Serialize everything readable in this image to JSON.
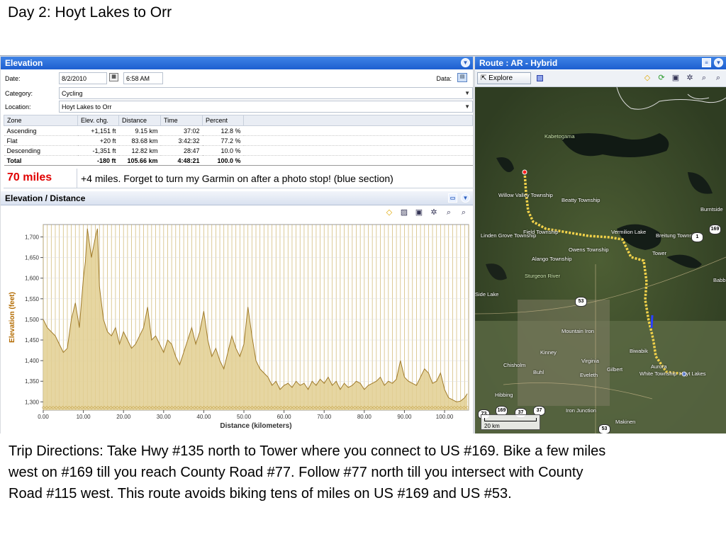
{
  "slide_title": "Day 2: Hoyt Lakes to Orr",
  "elevation_pane": {
    "title": "Elevation",
    "date_label": "Date:",
    "date_value": "8/2/2010",
    "time_value": "6:58 AM",
    "data_label": "Data:",
    "category_label": "Category:",
    "category_value": "Cycling",
    "location_label": "Location:",
    "location_value": "Hoyt Lakes to Orr",
    "zones": {
      "headers": [
        "Zone",
        "Elev. chg.",
        "Distance",
        "Time",
        "Percent"
      ],
      "rows": [
        [
          "Ascending",
          "+1,151 ft",
          "9.15 km",
          "37:02",
          "12.8 %"
        ],
        [
          "Flat",
          "+20 ft",
          "83.68 km",
          "3:42:32",
          "77.2 %"
        ],
        [
          "Descending",
          "-1,351 ft",
          "12.82 km",
          "28:47",
          "10.0 %"
        ]
      ],
      "total": [
        "Total",
        "-180 ft",
        "105.66 km",
        "4:48:21",
        "100.0 %"
      ]
    },
    "note_red": "70 miles",
    "note_text": "+4 miles. Forget to turn my Garmin on after a photo stop! (blue section)"
  },
  "elevation_distance": {
    "title": "Elevation / Distance"
  },
  "chart_data": {
    "type": "area",
    "xlabel": "Distance (kilometers)",
    "ylabel": "Elevation (feet)",
    "xlim": [
      0,
      106
    ],
    "ylim": [
      1280,
      1730
    ],
    "x_ticks": [
      "0.00",
      "10.00",
      "20.00",
      "30.00",
      "40.00",
      "50.00",
      "60.00",
      "70.00",
      "80.00",
      "90.00",
      "100.00"
    ],
    "y_ticks": [
      "1,300",
      "1,350",
      "1,400",
      "1,450",
      "1,500",
      "1,550",
      "1,600",
      "1,650",
      "1,700"
    ],
    "grid": true,
    "fill_color": "#e2cf92",
    "line_color": "#a07b2a",
    "x": [
      0,
      1,
      2,
      3,
      4,
      5,
      6,
      7,
      8,
      9,
      10,
      10.5,
      11,
      12,
      13,
      13.5,
      14,
      15,
      16,
      17,
      18,
      19,
      20,
      21,
      22,
      23,
      24,
      25,
      26,
      27,
      28,
      29,
      30,
      31,
      32,
      33,
      34,
      35,
      36,
      37,
      38,
      39,
      40,
      41,
      42,
      43,
      44,
      45,
      46,
      47,
      48,
      49,
      50,
      51,
      52,
      53,
      54,
      55,
      56,
      57,
      58,
      59,
      60,
      61,
      62,
      63,
      64,
      65,
      66,
      67,
      68,
      69,
      70,
      71,
      72,
      73,
      74,
      75,
      76,
      77,
      78,
      79,
      80,
      81,
      82,
      83,
      84,
      85,
      86,
      87,
      88,
      89,
      90,
      91,
      92,
      93,
      94,
      95,
      96,
      97,
      98,
      99,
      100,
      101,
      102,
      103,
      104,
      105,
      105.66
    ],
    "y": [
      1500,
      1480,
      1470,
      1460,
      1440,
      1420,
      1430,
      1500,
      1540,
      1480,
      1600,
      1640,
      1720,
      1650,
      1700,
      1720,
      1580,
      1500,
      1470,
      1460,
      1480,
      1440,
      1470,
      1450,
      1430,
      1440,
      1460,
      1480,
      1530,
      1450,
      1460,
      1440,
      1420,
      1450,
      1440,
      1410,
      1390,
      1420,
      1450,
      1480,
      1440,
      1470,
      1520,
      1450,
      1410,
      1430,
      1400,
      1380,
      1420,
      1460,
      1430,
      1410,
      1440,
      1530,
      1460,
      1400,
      1380,
      1370,
      1360,
      1340,
      1350,
      1330,
      1340,
      1345,
      1335,
      1350,
      1340,
      1345,
      1330,
      1350,
      1340,
      1355,
      1345,
      1360,
      1340,
      1350,
      1330,
      1345,
      1335,
      1340,
      1350,
      1345,
      1330,
      1340,
      1345,
      1350,
      1360,
      1340,
      1350,
      1345,
      1355,
      1400,
      1360,
      1350,
      1345,
      1340,
      1360,
      1380,
      1370,
      1345,
      1350,
      1370,
      1330,
      1310,
      1305,
      1300,
      1302,
      1310,
      1320
    ]
  },
  "route_pane": {
    "title": "Route : AR - Hybrid",
    "explore_label": "Explore",
    "scale_label": "20 km",
    "labels": [
      {
        "text": "Kabetogama",
        "green": true
      },
      {
        "text": "Willow Valley Township"
      },
      {
        "text": "Beatty Township"
      },
      {
        "text": "Burntside"
      },
      {
        "text": "Linden Grove Township"
      },
      {
        "text": "Field Township"
      },
      {
        "text": "Owens Township"
      },
      {
        "text": "Vermilion Lake"
      },
      {
        "text": "Breitung Township"
      },
      {
        "text": "Tower"
      },
      {
        "text": "Alango Township"
      },
      {
        "text": "Sturgeon River",
        "green": true
      },
      {
        "text": "Side Lake"
      },
      {
        "text": "Babbitt"
      },
      {
        "text": "Mountain Iron"
      },
      {
        "text": "Kinney"
      },
      {
        "text": "Biwabik"
      },
      {
        "text": "Aurora"
      },
      {
        "text": "Hoyt Lakes"
      },
      {
        "text": "Chisholm"
      },
      {
        "text": "Buhl"
      },
      {
        "text": "Virginia"
      },
      {
        "text": "Gilbert"
      },
      {
        "text": "Eveleth"
      },
      {
        "text": "White Township"
      },
      {
        "text": "Hibbing"
      },
      {
        "text": "Iron Junction"
      },
      {
        "text": "Makinen"
      }
    ],
    "shields": [
      "169",
      "1",
      "53",
      "169",
      "37",
      "37",
      "53",
      "73"
    ]
  },
  "directions": "Trip Directions: Take Hwy #135 north to Tower where you connect to US #169. Bike a few miles west on #169 till you reach County Road #77. Follow #77 north till you intersect with County Road #115 west. This route avoids biking tens of miles on US #169 and US #53."
}
